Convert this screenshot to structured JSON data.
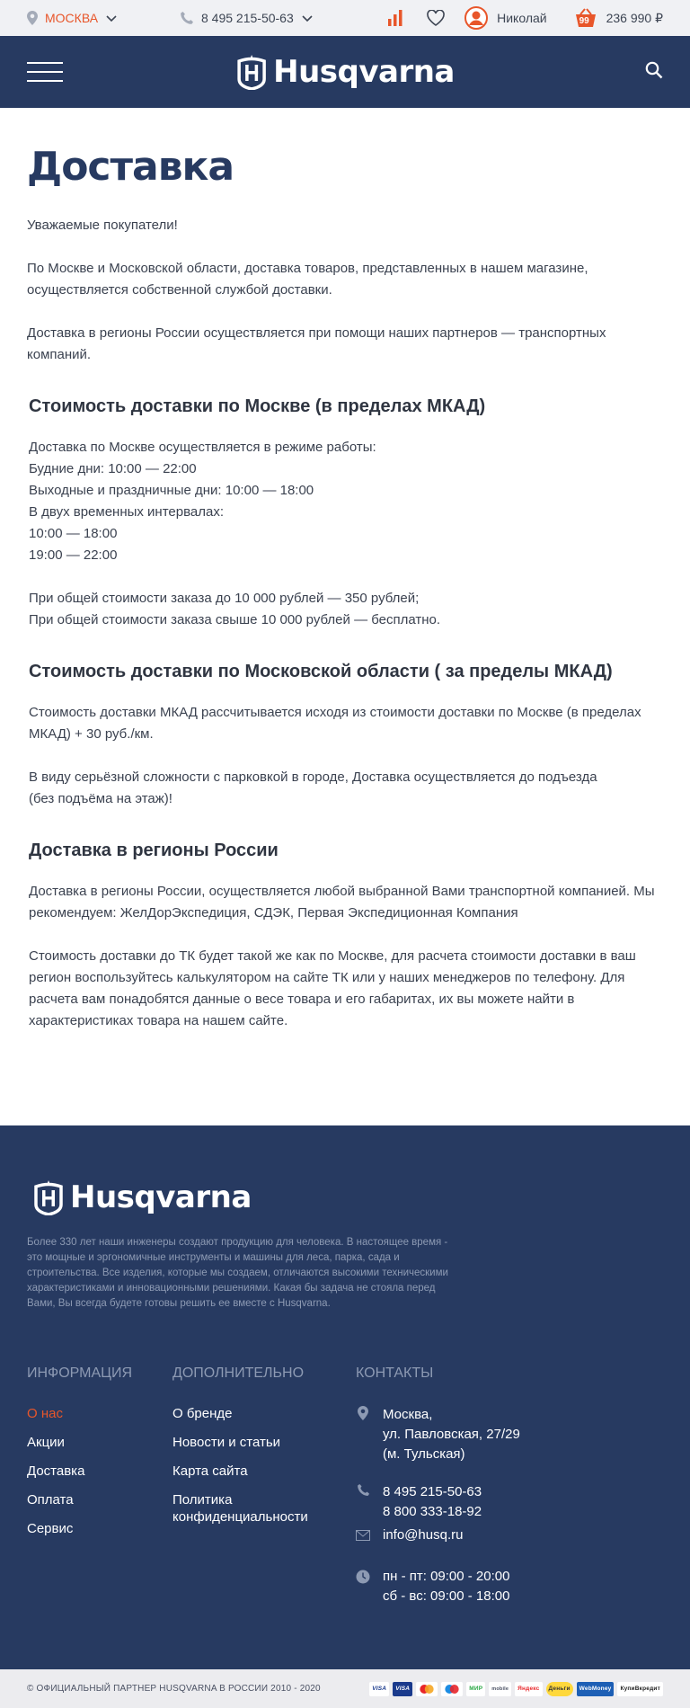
{
  "topbar": {
    "city": "МОСКВА",
    "phone": "8 495 215-50-63",
    "user_name": "Николай",
    "cart_count": "99",
    "cart_total": "236 990 ₽"
  },
  "header": {
    "logo_text": "Husqvarna"
  },
  "main": {
    "title": "Доставка",
    "intro": [
      "Уважаемые покупатели!",
      "По Москве и Московской области, доставка товаров, представленных в нашем магазине, осуществляется собственной службой доставки.",
      "Доставка в регионы России осуществляется при помощи наших партнеров —  транспортных компаний."
    ],
    "sections": [
      {
        "title": "Стоимость доставки по Москве (в пределах МКАД)",
        "block1": [
          "Доставка по Москве осуществляется в режиме работы:",
          "Будние дни: 10:00 — 22:00",
          "Выходные и праздничные дни: 10:00 — 18:00",
          "В двух временных интервалах:",
          "10:00 — 18:00",
          "19:00 — 22:00"
        ],
        "block2": [
          "При общей стоимости заказа до 10 000 рублей — 350 рублей;",
          "При общей стоимости заказа свыше 10 000 рублей — бесплатно."
        ]
      },
      {
        "title": "Стоимость доставки по Московской области ( за пределы МКАД)",
        "para1": "Стоимость доставки МКАД рассчитывается исходя из стоимости доставки по Москве (в пределах МКАД) + 30 руб./км.",
        "para2_line1": "В виду серьёзной сложности с парковкой в городе, Доставка осуществляется до подъезда",
        "para2_line2": "(без подъёма на этаж)!"
      },
      {
        "title": "Доставка в регионы России",
        "para1": "Доставка в регионы России, осуществляется любой выбранной Вами транспортной компанией. Мы рекомендуем: ЖелДорЭкспедиция, СДЭК, Первая Экспедиционная Компания",
        "para2": "Стоимость доставки до ТК будет такой же как по Москве, для расчета стоимости доставки в ваш регион воспользуйтесь калькулятором на сайте ТК или у наших менеджеров по телефону. Для расчета вам понадобятся данные о весе товара и его габаритах, их вы можете найти в характеристиках товара на нашем сайте."
      }
    ]
  },
  "footer": {
    "logo_text": "Husqvarna",
    "about": "Более 330 лет наши инженеры создают продукцию для человека. В настоящее время - это мощные и эргономичные инструменты и машины для леса, парка, сада и строительства. Все изделия, которые мы создаем, отличаются высокими техническими характеристиками и инновационными решениями. Какая бы задача не стояла перед Вами, Вы всегда будете готовы решить ее вместе с Husqvarna.",
    "col1": {
      "title": "ИНФОРМАЦИЯ",
      "links": [
        "О нас",
        "Акции",
        "Доставка",
        "Оплата",
        "Сервис"
      ]
    },
    "col2": {
      "title": "ДОПОЛНИТЕЛЬНО",
      "links": [
        "О бренде",
        "Новости и статьи",
        "Карта сайта",
        "Политика конфиденциальности"
      ]
    },
    "col3": {
      "title": "КОНТАКТЫ",
      "address": [
        "Москва,",
        "ул. Павловская, 27/29",
        "(м. Тульская)"
      ],
      "phones": [
        "8 495 215-50-63",
        "8 800 333-18-92"
      ],
      "email": "info@husq.ru",
      "hours": [
        "пн - пт: 09:00 - 20:00",
        "сб - вс: 09:00 - 18:00"
      ]
    },
    "copyright": "© ОФИЦИАЛЬНЫЙ ПАРТНЕР HUSQVARNA В РОССИИ 2010 - 2020",
    "payments": [
      "VISA",
      "VISA",
      "mastercard",
      "maestro",
      "МИР",
      "mobile",
      "Яндекс",
      "Деньги",
      "WebMoney",
      "КупиВкредит"
    ]
  },
  "colors": {
    "brand_navy": "#273a61",
    "accent_orange": "#e8562a",
    "topbar_bg": "#f0f1f4"
  }
}
